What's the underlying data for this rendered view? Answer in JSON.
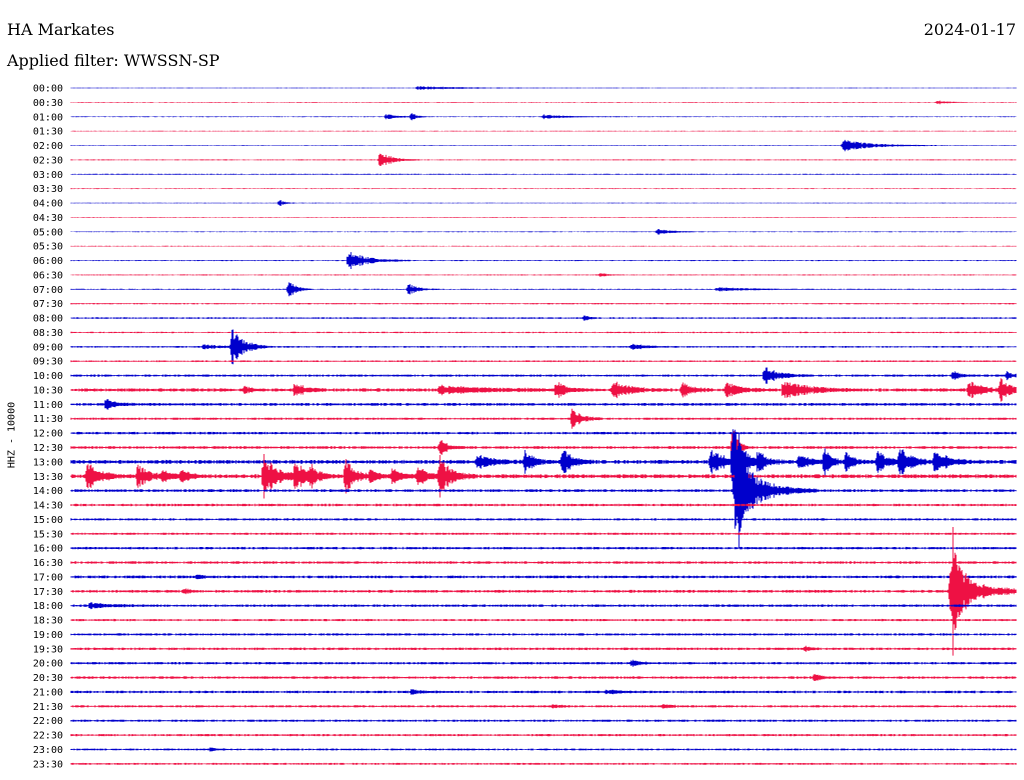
{
  "header": {
    "station": "HA Markates",
    "date": "2024-01-17",
    "filter": "Applied filter: WWSSN-SP"
  },
  "chart_data": {
    "type": "line",
    "title": "HA Markates",
    "subtitle": "Applied filter: WWSSN-SP",
    "ylabel": "HHZ - 10000",
    "xlabel": "",
    "colors": {
      "even": "#0000cc",
      "odd": "#ee1144"
    },
    "rows": [
      "00:00",
      "00:30",
      "01:00",
      "01:30",
      "02:00",
      "02:30",
      "03:00",
      "03:30",
      "04:00",
      "04:30",
      "05:00",
      "05:30",
      "06:00",
      "06:30",
      "07:00",
      "07:30",
      "08:00",
      "08:30",
      "09:00",
      "09:30",
      "10:00",
      "10:30",
      "11:00",
      "11:30",
      "12:00",
      "12:30",
      "13:00",
      "13:30",
      "14:00",
      "14:30",
      "15:00",
      "15:30",
      "16:00",
      "16:30",
      "17:00",
      "17:30",
      "18:00",
      "18:30",
      "19:00",
      "19:30",
      "20:00",
      "20:30",
      "21:00",
      "21:30",
      "22:00",
      "22:30",
      "23:00",
      "23:30"
    ],
    "noise_level": [
      0.3,
      0.3,
      0.3,
      0.3,
      0.3,
      0.4,
      0.4,
      0.3,
      0.3,
      0.3,
      0.3,
      0.3,
      0.4,
      0.4,
      0.4,
      0.5,
      0.6,
      0.5,
      0.6,
      0.6,
      0.8,
      1.2,
      1.0,
      0.8,
      0.9,
      1.0,
      1.4,
      1.4,
      1.0,
      0.9,
      0.8,
      0.8,
      0.9,
      0.9,
      1.0,
      1.0,
      0.9,
      0.8,
      0.8,
      0.9,
      0.9,
      0.9,
      0.9,
      0.8,
      0.8,
      0.8,
      0.7,
      0.7
    ],
    "events": [
      {
        "row": 0,
        "minute": 11.0,
        "amp": 2,
        "dur": 1.5
      },
      {
        "row": 1,
        "minute": 27.5,
        "amp": 2,
        "dur": 0.4
      },
      {
        "row": 2,
        "minute": 10.0,
        "amp": 3,
        "dur": 0.5
      },
      {
        "row": 2,
        "minute": 10.8,
        "amp": 4,
        "dur": 0.2
      },
      {
        "row": 2,
        "minute": 15.0,
        "amp": 2,
        "dur": 1.0
      },
      {
        "row": 4,
        "minute": 24.5,
        "amp": 6,
        "dur": 1.2
      },
      {
        "row": 5,
        "minute": 9.8,
        "amp": 9,
        "dur": 0.5
      },
      {
        "row": 8,
        "minute": 6.6,
        "amp": 4,
        "dur": 0.2
      },
      {
        "row": 10,
        "minute": 18.6,
        "amp": 3,
        "dur": 0.6
      },
      {
        "row": 12,
        "minute": 8.8,
        "amp": 10,
        "dur": 0.8
      },
      {
        "row": 13,
        "minute": 16.8,
        "amp": 3,
        "dur": 0.2
      },
      {
        "row": 14,
        "minute": 6.9,
        "amp": 11,
        "dur": 0.3
      },
      {
        "row": 14,
        "minute": 10.7,
        "amp": 6,
        "dur": 0.4
      },
      {
        "row": 14,
        "minute": 20.5,
        "amp": 2,
        "dur": 1.4
      },
      {
        "row": 16,
        "minute": 16.3,
        "amp": 3,
        "dur": 0.2
      },
      {
        "row": 18,
        "minute": 4.2,
        "amp": 2,
        "dur": 0.8
      },
      {
        "row": 18,
        "minute": 5.1,
        "amp": 20,
        "dur": 0.5
      },
      {
        "row": 18,
        "minute": 17.8,
        "amp": 3,
        "dur": 0.6
      },
      {
        "row": 20,
        "minute": 22.0,
        "amp": 10,
        "dur": 0.6
      },
      {
        "row": 20,
        "minute": 28.0,
        "amp": 5,
        "dur": 0.3
      },
      {
        "row": 20,
        "minute": 29.7,
        "amp": 4,
        "dur": 0.3
      },
      {
        "row": 21,
        "minute": 5.5,
        "amp": 4,
        "dur": 0.3
      },
      {
        "row": 21,
        "minute": 7.1,
        "amp": 8,
        "dur": 0.4
      },
      {
        "row": 21,
        "minute": 11.7,
        "amp": 4,
        "dur": 2.0
      },
      {
        "row": 21,
        "minute": 15.4,
        "amp": 9,
        "dur": 0.4
      },
      {
        "row": 21,
        "minute": 17.2,
        "amp": 9,
        "dur": 0.7
      },
      {
        "row": 21,
        "minute": 19.4,
        "amp": 9,
        "dur": 0.4
      },
      {
        "row": 21,
        "minute": 20.8,
        "amp": 8,
        "dur": 0.6
      },
      {
        "row": 21,
        "minute": 22.6,
        "amp": 10,
        "dur": 1.0
      },
      {
        "row": 21,
        "minute": 28.5,
        "amp": 10,
        "dur": 0.5
      },
      {
        "row": 21,
        "minute": 29.5,
        "amp": 12,
        "dur": 0.5
      },
      {
        "row": 22,
        "minute": 1.1,
        "amp": 6,
        "dur": 0.4
      },
      {
        "row": 23,
        "minute": 15.9,
        "amp": 11,
        "dur": 0.4
      },
      {
        "row": 25,
        "minute": 11.7,
        "amp": 9,
        "dur": 0.3
      },
      {
        "row": 25,
        "minute": 21.0,
        "amp": 30,
        "dur": 0.2
      },
      {
        "row": 26,
        "minute": 12.9,
        "amp": 8,
        "dur": 0.6
      },
      {
        "row": 26,
        "minute": 14.4,
        "amp": 12,
        "dur": 0.4
      },
      {
        "row": 26,
        "minute": 15.6,
        "amp": 15,
        "dur": 0.4
      },
      {
        "row": 26,
        "minute": 20.3,
        "amp": 14,
        "dur": 0.6
      },
      {
        "row": 26,
        "minute": 21.0,
        "amp": 40,
        "dur": 0.4
      },
      {
        "row": 26,
        "minute": 21.8,
        "amp": 10,
        "dur": 0.4
      },
      {
        "row": 26,
        "minute": 23.1,
        "amp": 11,
        "dur": 0.4
      },
      {
        "row": 26,
        "minute": 23.9,
        "amp": 14,
        "dur": 0.3
      },
      {
        "row": 26,
        "minute": 24.6,
        "amp": 11,
        "dur": 0.3
      },
      {
        "row": 26,
        "minute": 25.6,
        "amp": 13,
        "dur": 0.4
      },
      {
        "row": 26,
        "minute": 26.3,
        "amp": 14,
        "dur": 0.6
      },
      {
        "row": 26,
        "minute": 27.4,
        "amp": 12,
        "dur": 0.6
      },
      {
        "row": 27,
        "minute": 0.5,
        "amp": 14,
        "dur": 0.6
      },
      {
        "row": 27,
        "minute": 2.1,
        "amp": 13,
        "dur": 0.5
      },
      {
        "row": 27,
        "minute": 2.9,
        "amp": 6,
        "dur": 0.4
      },
      {
        "row": 27,
        "minute": 3.5,
        "amp": 6,
        "dur": 0.4
      },
      {
        "row": 27,
        "minute": 6.1,
        "amp": 22,
        "dur": 0.6
      },
      {
        "row": 27,
        "minute": 7.1,
        "amp": 16,
        "dur": 0.5
      },
      {
        "row": 27,
        "minute": 7.6,
        "amp": 10,
        "dur": 0.3
      },
      {
        "row": 27,
        "minute": 8.7,
        "amp": 18,
        "dur": 0.4
      },
      {
        "row": 27,
        "minute": 9.5,
        "amp": 8,
        "dur": 0.3
      },
      {
        "row": 27,
        "minute": 10.2,
        "amp": 8,
        "dur": 0.4
      },
      {
        "row": 27,
        "minute": 11.0,
        "amp": 10,
        "dur": 0.4
      },
      {
        "row": 27,
        "minute": 11.7,
        "amp": 20,
        "dur": 0.5
      },
      {
        "row": 28,
        "minute": 21.2,
        "amp": 30,
        "dur": 1.0
      },
      {
        "row": 28,
        "minute": 21.1,
        "amp": 60,
        "dur": 0.25
      },
      {
        "row": 34,
        "minute": 4.0,
        "amp": 3,
        "dur": 0.2
      },
      {
        "row": 35,
        "minute": 3.6,
        "amp": 3,
        "dur": 0.2
      },
      {
        "row": 35,
        "minute": 27.9,
        "amp": 25,
        "dur": 1.1
      },
      {
        "row": 35,
        "minute": 28.0,
        "amp": 45,
        "dur": 0.3
      },
      {
        "row": 36,
        "minute": 0.6,
        "amp": 3,
        "dur": 0.8
      },
      {
        "row": 39,
        "minute": 23.3,
        "amp": 3,
        "dur": 0.2
      },
      {
        "row": 40,
        "minute": 17.8,
        "amp": 3,
        "dur": 0.4
      },
      {
        "row": 41,
        "minute": 23.6,
        "amp": 4,
        "dur": 0.3
      },
      {
        "row": 42,
        "minute": 10.8,
        "amp": 2,
        "dur": 0.5
      },
      {
        "row": 42,
        "minute": 17.0,
        "amp": 2,
        "dur": 0.7
      },
      {
        "row": 43,
        "minute": 15.3,
        "amp": 2,
        "dur": 0.3
      },
      {
        "row": 43,
        "minute": 18.8,
        "amp": 2,
        "dur": 0.4
      },
      {
        "row": 46,
        "minute": 4.4,
        "amp": 2,
        "dur": 0.3
      }
    ]
  }
}
